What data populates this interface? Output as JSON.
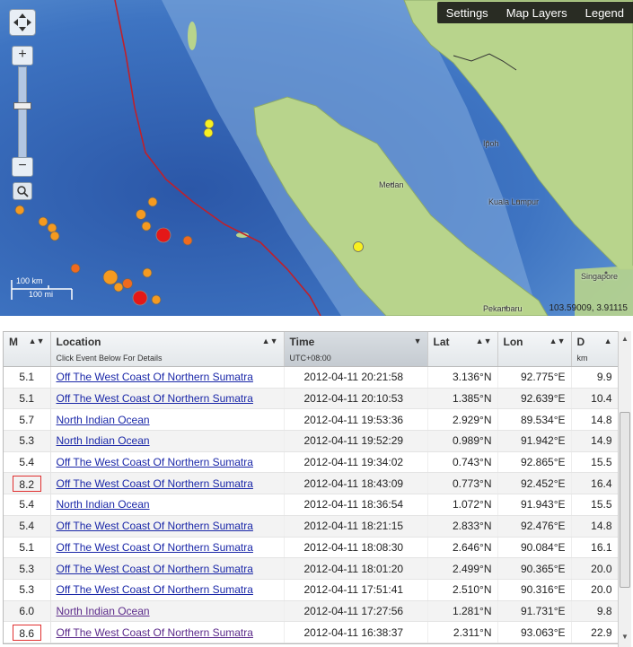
{
  "map": {
    "menu": [
      "Settings",
      "Map Layers",
      "Legend"
    ],
    "zoom_in": "+",
    "zoom_out": "−",
    "scale_km": "100 km",
    "scale_mi": "100 mi",
    "coords": "103.59009, 3.91115",
    "cities": [
      "Ipoh",
      "Medan",
      "Kuala Lumpur",
      "Singapore",
      "Pekanbaru"
    ]
  },
  "table": {
    "headers": {
      "m": "M",
      "location": "Location",
      "location_sub": "Click Event Below For Details",
      "time": "Time",
      "time_sub": "UTC+08:00",
      "lat": "Lat",
      "lon": "Lon",
      "depth": "D",
      "depth_sub": "km"
    },
    "rows": [
      {
        "m": "5.1",
        "location": "Off The West Coast Of Northern Sumatra",
        "time": "2012-04-11 20:21:58",
        "lat": "3.136°N",
        "lon": "92.775°E",
        "depth": "9.9"
      },
      {
        "m": "5.1",
        "location": "Off The West Coast Of Northern Sumatra",
        "time": "2012-04-11 20:10:53",
        "lat": "1.385°N",
        "lon": "92.639°E",
        "depth": "10.4"
      },
      {
        "m": "5.7",
        "location": "North Indian Ocean",
        "time": "2012-04-11 19:53:36",
        "lat": "2.929°N",
        "lon": "89.534°E",
        "depth": "14.8"
      },
      {
        "m": "5.3",
        "location": "North Indian Ocean",
        "time": "2012-04-11 19:52:29",
        "lat": "0.989°N",
        "lon": "91.942°E",
        "depth": "14.9"
      },
      {
        "m": "5.4",
        "location": "Off The West Coast Of Northern Sumatra",
        "time": "2012-04-11 19:34:02",
        "lat": "0.743°N",
        "lon": "92.865°E",
        "depth": "15.5"
      },
      {
        "m": "8.2",
        "location": "Off The West Coast Of Northern Sumatra",
        "time": "2012-04-11 18:43:09",
        "lat": "0.773°N",
        "lon": "92.452°E",
        "depth": "16.4"
      },
      {
        "m": "5.4",
        "location": "North Indian Ocean",
        "time": "2012-04-11 18:36:54",
        "lat": "1.072°N",
        "lon": "91.943°E",
        "depth": "15.5"
      },
      {
        "m": "5.4",
        "location": "Off The West Coast Of Northern Sumatra",
        "time": "2012-04-11 18:21:15",
        "lat": "2.833°N",
        "lon": "92.476°E",
        "depth": "14.8"
      },
      {
        "m": "5.1",
        "location": "Off The West Coast Of Northern Sumatra",
        "time": "2012-04-11 18:08:30",
        "lat": "2.646°N",
        "lon": "90.084°E",
        "depth": "16.1"
      },
      {
        "m": "5.3",
        "location": "Off The West Coast Of Northern Sumatra",
        "time": "2012-04-11 18:01:20",
        "lat": "2.499°N",
        "lon": "90.365°E",
        "depth": "20.0"
      },
      {
        "m": "5.3",
        "location": "Off The West Coast Of Northern Sumatra",
        "time": "2012-04-11 17:51:41",
        "lat": "2.510°N",
        "lon": "90.316°E",
        "depth": "20.0"
      },
      {
        "m": "6.0",
        "location": "North Indian Ocean",
        "time": "2012-04-11 17:27:56",
        "lat": "1.281°N",
        "lon": "91.731°E",
        "depth": "9.8"
      },
      {
        "m": "8.6",
        "location": "Off The West Coast Of Northern Sumatra",
        "time": "2012-04-11 16:38:37",
        "lat": "2.311°N",
        "lon": "93.063°E",
        "depth": "22.9"
      }
    ]
  }
}
